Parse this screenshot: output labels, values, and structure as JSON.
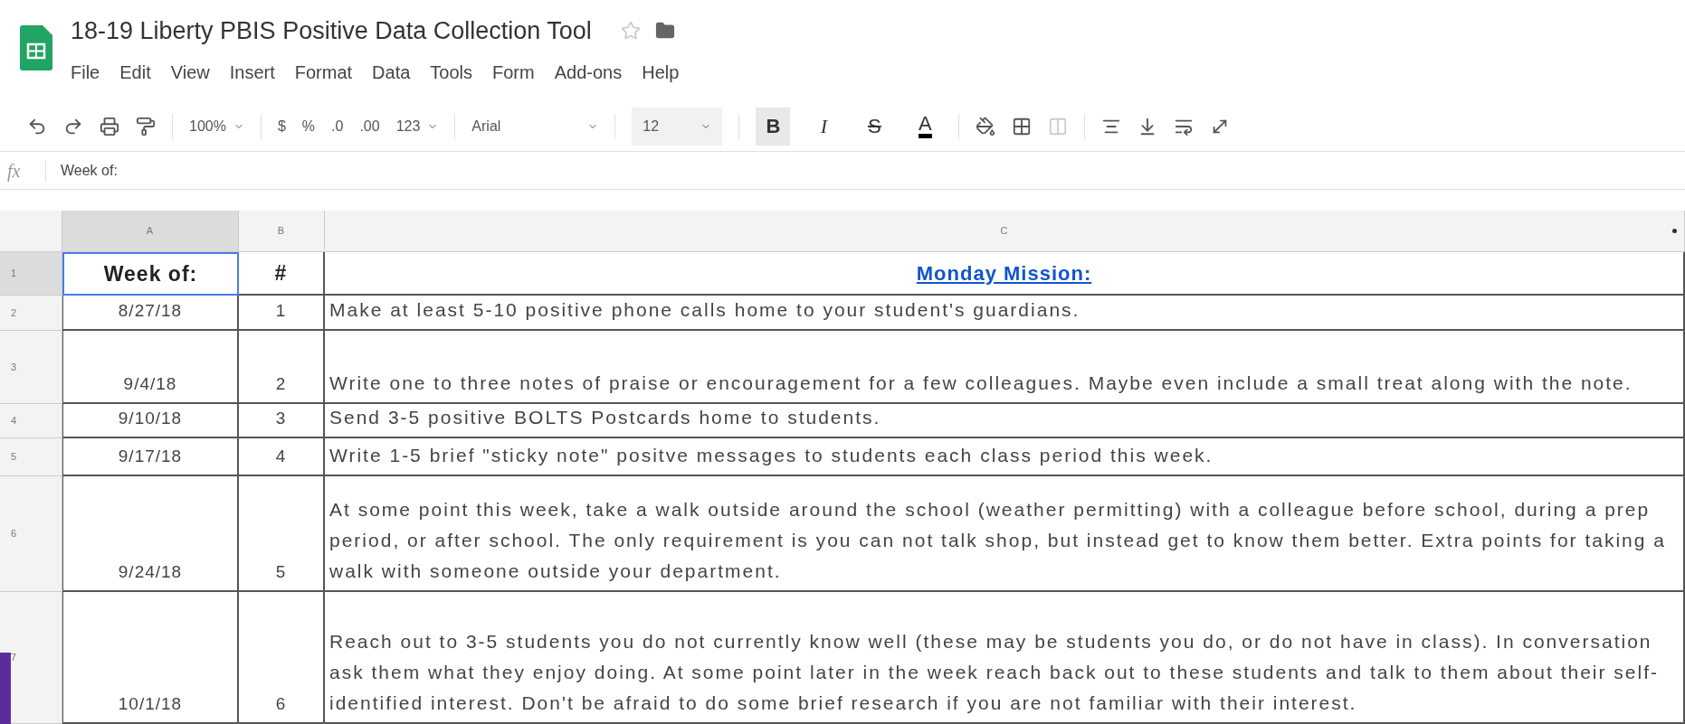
{
  "document": {
    "title": "18-19 Liberty PBIS Positive Data Collection Tool",
    "starred": false
  },
  "menu": [
    "File",
    "Edit",
    "View",
    "Insert",
    "Format",
    "Data",
    "Tools",
    "Form",
    "Add-ons",
    "Help"
  ],
  "toolbar": [
    {
      "kind": "icon"
    },
    {
      "kind": "icon"
    },
    {
      "kind": "icon"
    },
    {
      "kind": "icon"
    },
    {
      "kind": "divider"
    },
    {
      "kind": "dropdown",
      "label": "100%"
    },
    {
      "kind": "divider"
    },
    {
      "kind": "text",
      "label": "$"
    },
    {
      "kind": "text",
      "label": "%"
    },
    {
      "kind": "text",
      "label": ".0"
    },
    {
      "kind": "text",
      "label": ".00"
    },
    {
      "kind": "dropdown",
      "label": "123"
    },
    {
      "kind": "divider"
    },
    {
      "kind": "font",
      "label": "Arial"
    },
    {
      "kind": "divider"
    },
    {
      "kind": "size",
      "label": "12"
    },
    {
      "kind": "divider"
    },
    {
      "kind": "bold",
      "label": "B",
      "active": true
    },
    {
      "kind": "italic",
      "label": "I",
      "active": false
    },
    {
      "kind": "strike",
      "label": "S",
      "active": false
    },
    {
      "kind": "color",
      "label": "A",
      "active": false
    },
    {
      "kind": "divider"
    },
    {
      "kind": "icon"
    },
    {
      "kind": "icon"
    },
    {
      "kind": "icon"
    },
    {
      "kind": "divider"
    },
    {
      "kind": "icon"
    },
    {
      "kind": "icon"
    },
    {
      "kind": "icon"
    },
    {
      "kind": "icon"
    }
  ],
  "formula_bar": {
    "label": "fx",
    "value": "Week of:"
  },
  "columns": [
    {
      "label": "A",
      "selected": true
    },
    {
      "label": "B",
      "selected": false
    },
    {
      "label": "C",
      "selected": false
    }
  ],
  "header_row": {
    "row": "1",
    "week": "Week of:",
    "number": "#",
    "mission": "Monday Mission:"
  },
  "rows": [
    {
      "row": "2",
      "week": "8/27/18",
      "number": "1",
      "mission": "Make at least 5-10 positive phone calls home to your student's guardians."
    },
    {
      "row": "3",
      "week": "9/4/18",
      "number": "2",
      "mission": "Write one to three notes of praise or encouragement for a few colleagues. Maybe even include a small treat along with the note."
    },
    {
      "row": "4",
      "week": "9/10/18",
      "number": "3",
      "mission": "Send 3-5 positive BOLTS Postcards home to students."
    },
    {
      "row": "5",
      "week": "9/17/18",
      "number": "4",
      "mission": "Write 1-5 brief \"sticky note\" positve messages to students each class period this week."
    },
    {
      "row": "6",
      "week": "9/24/18",
      "number": "5",
      "mission": "At some point this week, take a walk outside around the school (weather permitting) with a colleague before school, during a prep period, or after school. The only requirement is you can not talk shop, but instead get to know them better. Extra points for taking a walk with someone outside your department."
    },
    {
      "row": "7",
      "week": "10/1/18",
      "number": "6",
      "mission": "Reach out to 3-5 students you do not currently know well (these may be students you do, or do not have in class). In conversation ask them what they enjoy doing. At some point later in the week reach back out to these students and talk to them about their self-identified interest. Don't be afraid to do some brief research if you are not familiar with their interest."
    }
  ]
}
